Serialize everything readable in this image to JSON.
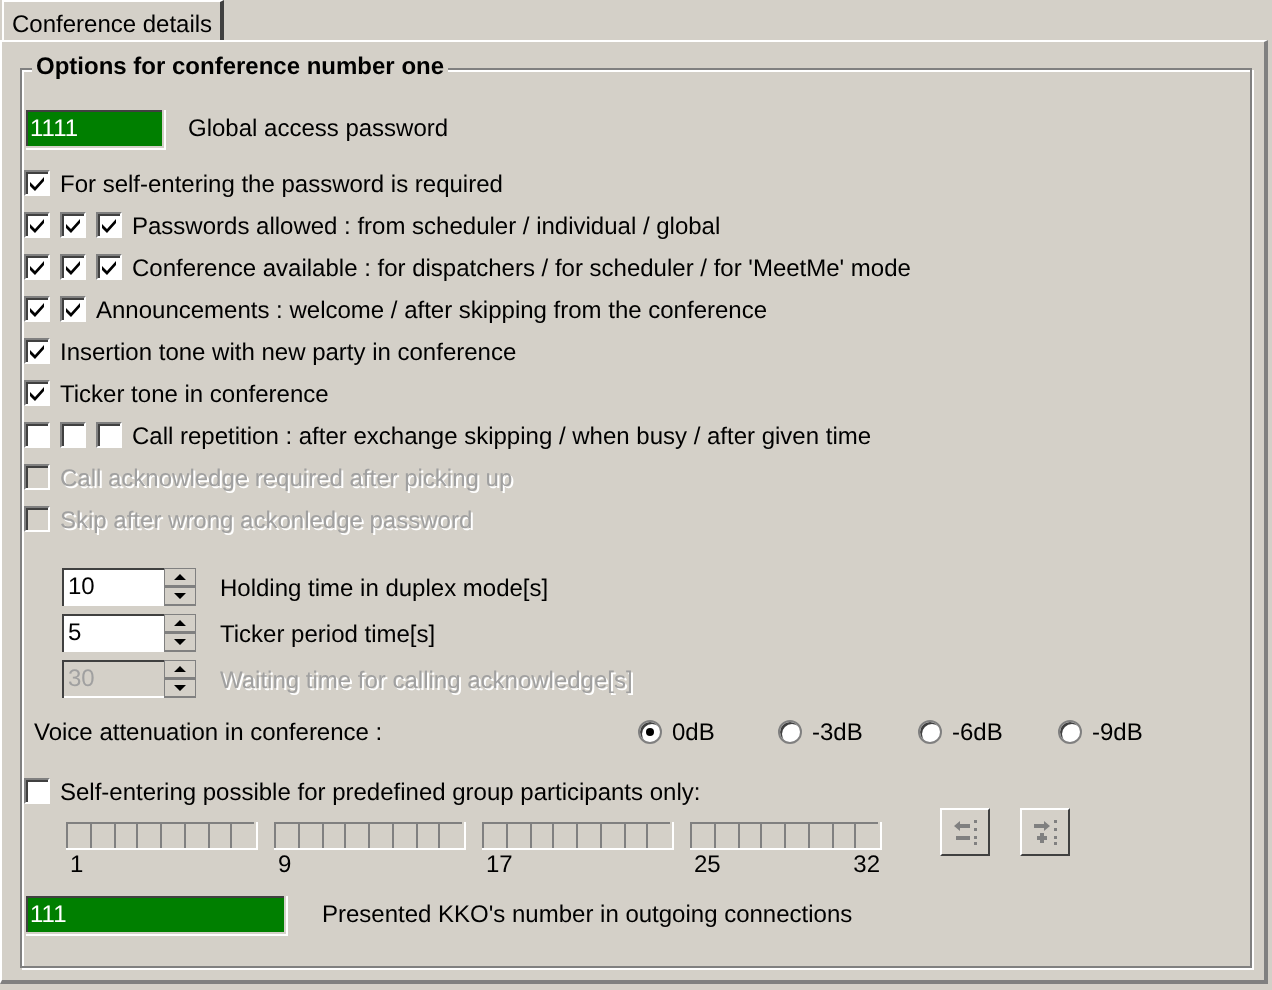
{
  "tabs": [
    {
      "label": "Conference details",
      "selected": true
    }
  ],
  "group": {
    "title": "Options for conference number one",
    "access_password": {
      "value": "1111",
      "label": "Global access password"
    },
    "options": [
      {
        "checked": [
          true
        ],
        "label": "For self-entering the password is required",
        "disabled": false
      },
      {
        "checked": [
          true,
          true,
          true
        ],
        "label": "Passwords allowed : from scheduler / individual / global",
        "disabled": false
      },
      {
        "checked": [
          true,
          true,
          true
        ],
        "label": "Conference available : for dispatchers / for scheduler / for 'MeetMe' mode",
        "disabled": false
      },
      {
        "checked": [
          true,
          true
        ],
        "label": "Announcements : welcome / after skipping from the conference",
        "disabled": false
      },
      {
        "checked": [
          true
        ],
        "label": "Insertion tone with new party in conference",
        "disabled": false
      },
      {
        "checked": [
          true
        ],
        "label": "Ticker tone in conference",
        "disabled": false
      },
      {
        "checked": [
          false,
          false,
          false
        ],
        "label": "Call repetition : after exchange skipping / when busy / after given time",
        "disabled": false
      },
      {
        "checked": [
          false
        ],
        "label": "Call acknowledge required after picking up",
        "disabled": true
      },
      {
        "checked": [
          false
        ],
        "label": "Skip after wrong ackonledge password",
        "disabled": true
      }
    ],
    "spinners": [
      {
        "value": "10",
        "label": "Holding time in duplex mode[s]",
        "disabled": false
      },
      {
        "value": "5",
        "label": "Ticker period time[s]",
        "disabled": false
      },
      {
        "value": "30",
        "label": "Waiting time for calling acknowledge[s]",
        "disabled": true
      }
    ],
    "attenuation": {
      "label": "Voice attenuation in conference :",
      "options": [
        {
          "label": "0dB",
          "selected": true
        },
        {
          "label": "-3dB",
          "selected": false
        },
        {
          "label": "-6dB",
          "selected": false
        },
        {
          "label": "-9dB",
          "selected": false
        }
      ]
    },
    "group_only": {
      "checked": false,
      "label": "Self-entering possible for predefined group participants only:"
    },
    "participant_bits": {
      "groups": [
        {
          "label": "1",
          "bits": [
            false,
            false,
            false,
            false,
            false,
            false,
            false,
            false
          ]
        },
        {
          "label": "9",
          "bits": [
            false,
            false,
            false,
            false,
            false,
            false,
            false,
            false
          ]
        },
        {
          "label": "17",
          "bits": [
            false,
            false,
            false,
            false,
            false,
            false,
            false,
            false
          ]
        },
        {
          "label": "25",
          "bits": [
            false,
            false,
            false,
            false,
            false,
            false,
            false,
            false
          ]
        }
      ],
      "end_label": "32"
    },
    "buttons": [
      {
        "kind": "remove",
        "disabled": true
      },
      {
        "kind": "add",
        "disabled": true
      }
    ],
    "kko": {
      "value": "111",
      "label": "Presented KKO's number in outgoing connections"
    }
  }
}
